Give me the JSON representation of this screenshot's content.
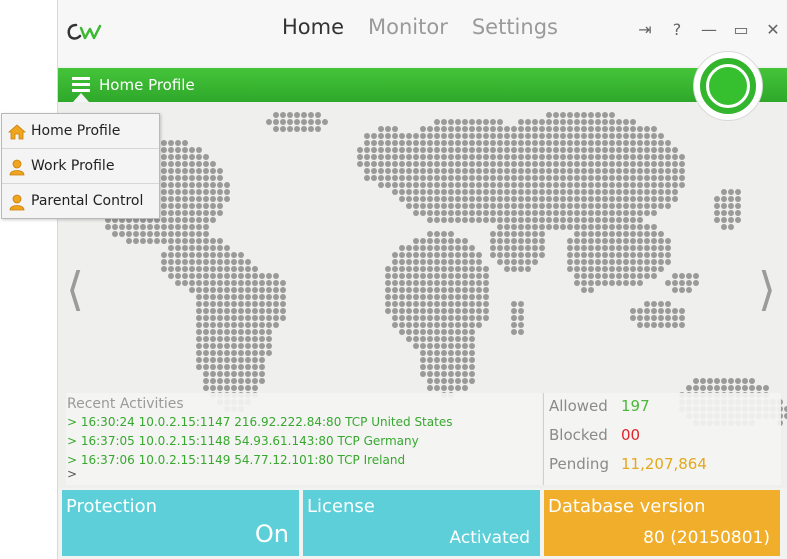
{
  "nav": {
    "tabs": [
      {
        "label": "Home",
        "active": true
      },
      {
        "label": "Monitor",
        "active": false
      },
      {
        "label": "Settings",
        "active": false
      }
    ]
  },
  "window_controls": {
    "pin": "⇥",
    "help": "?",
    "minimize": "—",
    "maximize": "▭",
    "close": "✕"
  },
  "profile": {
    "current": "Home Profile",
    "menu": [
      {
        "label": "Home Profile",
        "icon": "home-icon"
      },
      {
        "label": "Work Profile",
        "icon": "user-icon"
      },
      {
        "label": "Parental Control",
        "icon": "user-icon"
      }
    ]
  },
  "arrows": {
    "left": "⟨",
    "right": "⟩"
  },
  "activities": {
    "title": "Recent Activities",
    "lines": [
      "> 16:30:24   10.0.2.15:1147   216.92.222.84:80   TCP   United States",
      "> 16:37:05   10.0.2.15:1148   54.93.61.143:80   TCP   Germany",
      "> 16:37:06   10.0.2.15:1149   54.77.12.101:80   TCP   Ireland"
    ],
    "cursor": ">"
  },
  "stats": {
    "allowed_label": "Allowed",
    "allowed_value": "197",
    "blocked_label": "Blocked",
    "blocked_value": "00",
    "pending_label": "Pending",
    "pending_value": "11,207,864"
  },
  "tiles": {
    "protection": {
      "title": "Protection",
      "value": "On"
    },
    "license": {
      "title": "License",
      "value": "Activated"
    },
    "database": {
      "title": "Database version",
      "value": "80 (20150801)"
    }
  },
  "colors": {
    "brand_green": "#37b82f",
    "allowed": "#4cb83a",
    "blocked": "#e0242a",
    "pending": "#e3a81b",
    "tile_teal": "#5ccfd8",
    "tile_orange": "#f0ae2a"
  }
}
